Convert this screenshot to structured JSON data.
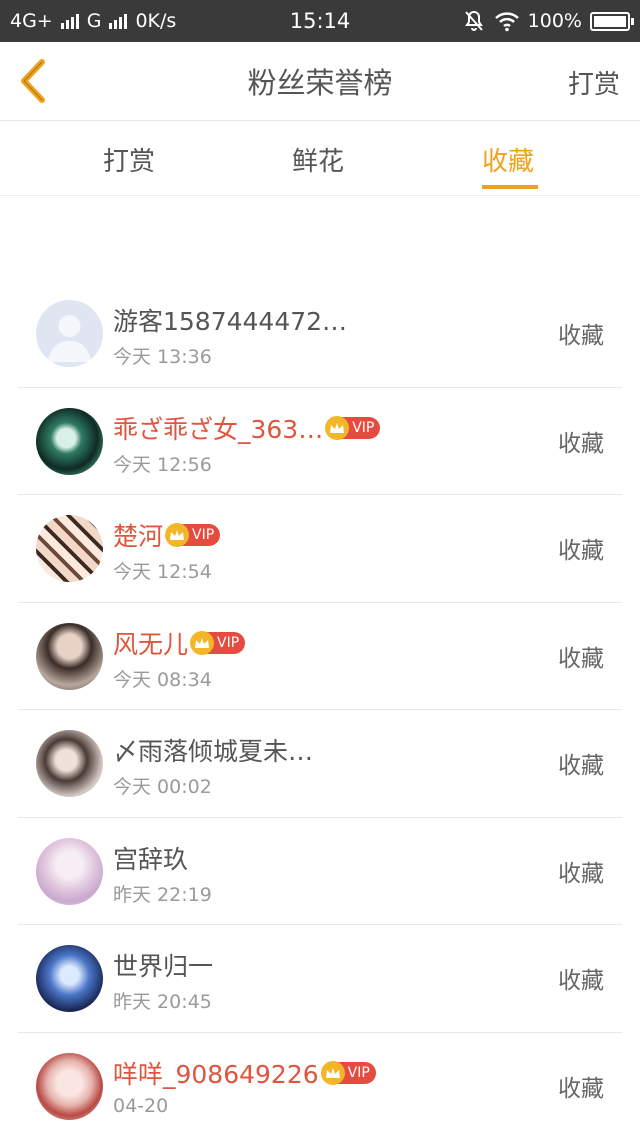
{
  "status_bar": {
    "network1": "4G+",
    "network2": "G",
    "speed": "0K/s",
    "time": "15:14",
    "battery": "100%"
  },
  "header": {
    "title": "粉丝荣誉榜",
    "right_label": "打赏"
  },
  "tabs": [
    {
      "label": "打赏",
      "active": false
    },
    {
      "label": "鲜花",
      "active": false
    },
    {
      "label": "收藏",
      "active": true
    }
  ],
  "colors": {
    "accent": "#f0a21c",
    "vip_name": "#e0553d",
    "vip_badge": "#e64b40",
    "crown": "#f3b628"
  },
  "vip_label": "VIP",
  "fans": [
    {
      "name": "游客1587444472…",
      "time": "今天 13:36",
      "action": "收藏",
      "vip": false
    },
    {
      "name": "乖ざ乖ざ女_363…",
      "time": "今天 12:56",
      "action": "收藏",
      "vip": true
    },
    {
      "name": "楚河",
      "time": "今天 12:54",
      "action": "收藏",
      "vip": true
    },
    {
      "name": "风无儿",
      "time": "今天 08:34",
      "action": "收藏",
      "vip": true
    },
    {
      "name": "〆雨落倾城夏未…",
      "time": "今天 00:02",
      "action": "收藏",
      "vip": false
    },
    {
      "name": "宫辞玖",
      "time": "昨天 22:19",
      "action": "收藏",
      "vip": false
    },
    {
      "name": "世界归一",
      "time": "昨天 20:45",
      "action": "收藏",
      "vip": false
    },
    {
      "name": "咩咩_908649226",
      "time": "04-20",
      "action": "收藏",
      "vip": true
    }
  ]
}
